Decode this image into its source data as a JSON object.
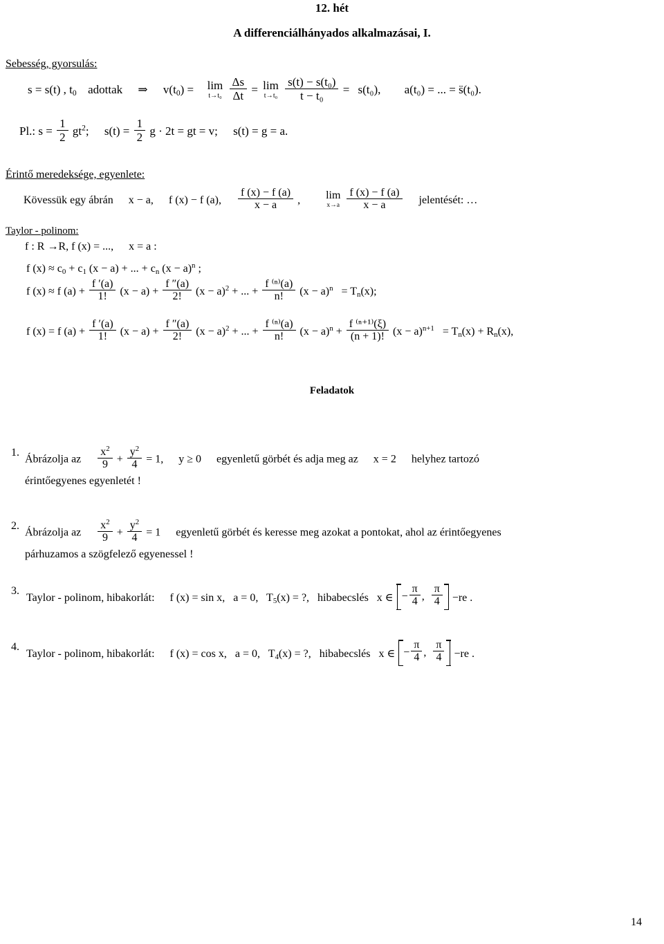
{
  "document": {
    "week_title": "12. hét",
    "main_title": "A differenciálhányados alkalmazásai, I.",
    "page_number": "14"
  },
  "section_velocity": {
    "heading": "Sebesség, gyorsulás:",
    "line1": {
      "lhs": "s = s(t) ,  t",
      "lhs_sub": "0",
      "given": "adottak",
      "implies": "⇒",
      "v_label": "v(t",
      "v_sub": "0",
      "v_close": ") =",
      "lim1_op": "lim",
      "lim1_under": "t→t₀",
      "frac1_num": "Δs",
      "frac1_den": "Δt",
      "eq1": "=",
      "lim2_op": "lim",
      "lim2_under": "t→t₀",
      "frac2_num": "s(t) − s(t₀)",
      "frac2_den": "t − t₀",
      "eq2": "=",
      "sdot": "s(t₀),",
      "accel": "a(t₀) = ... = s̈(t₀)."
    },
    "line2": {
      "prefix": "Pl.:  s =",
      "frac_num": "1",
      "frac_den": "2",
      "term1": "gt",
      "term1_sup": "2",
      "semi": ";",
      "sdot_label": "s(t) =",
      "frac2_num": "1",
      "frac2_den": "2",
      "term2": "g · 2t = gt = v;",
      "sddot_label": "s(t) = g = a."
    }
  },
  "section_tangent": {
    "heading": "Érintő meredeksége, egyenlete:",
    "lead": "Kövessük egy ábrán",
    "item1": "x − a,",
    "item2": "f (x) − f (a),",
    "frac_num": "f (x) − f (a)",
    "frac_den": "x − a",
    "comma": ",",
    "lim_op": "lim",
    "lim_under": "x→a",
    "frac2_num": "f (x) − f (a)",
    "frac2_den": "x − a",
    "trailing": "jelentését: …"
  },
  "section_taylor": {
    "heading": "Taylor - polinom:",
    "domain_line": "f : R →R,  f (x) = ...,",
    "domain_at": "x = a :",
    "approx_line": {
      "lhs": "f (x) ≈ c",
      "c0_sub": "0",
      "plus1": "+ c",
      "c1_sub": "1",
      "term1": "(x − a) + ... + c",
      "cn_sub": "n",
      "term2": "(x − a)",
      "term2_sup": "n",
      "semi": ";"
    },
    "formula_tn": {
      "lhs": "f (x) ≈ f (a) +",
      "f1_num": "f ′(a)",
      "f1_den": "1!",
      "t1": "(x − a) +",
      "f2_num": "f ″(a)",
      "f2_den": "2!",
      "t2": "(x − a)",
      "t2_sup": "2",
      "mid": "+ ... +",
      "fn_num": "f ⁽ⁿ⁾(a)",
      "fn_den": "n!",
      "t3": "(x − a)",
      "t3_sup": "n",
      "rhs": "= T",
      "rhs_sub": "n",
      "rhs_tail": "(x);"
    },
    "formula_full": {
      "lhs": "f (x) = f (a) +",
      "f1_num": "f ′(a)",
      "f1_den": "1!",
      "t1": "(x − a) +",
      "f2_num": "f ″(a)",
      "f2_den": "2!",
      "t2": "(x − a)",
      "t2_sup": "2",
      "mid": "+ ... +",
      "fn_num": "f ⁽ⁿ⁾(a)",
      "fn_den": "n!",
      "t3": "(x − a)",
      "t3_sup": "n",
      "plus": "+",
      "fr_num": "f ⁽ⁿ⁺¹⁾(ξ)",
      "fr_den": "(n + 1)!",
      "t4": "(x − a)",
      "t4_sup": "n+1",
      "rhs": "= T",
      "rhs_sub": "n",
      "rhs_mid": "(x) + R",
      "rhs_sub2": "n",
      "rhs_tail": "(x),"
    }
  },
  "exercises_heading": "Feladatok",
  "exercises": [
    {
      "num": "1.",
      "pre": "Ábrázolja  az",
      "frac1_num": "x",
      "frac1_num_sup": "2",
      "frac1_den": "9",
      "plus": "+",
      "frac2_num": "y",
      "frac2_num_sup": "2",
      "frac2_den": "4",
      "eq": "= 1,",
      "cond": "y ≥ 0",
      "mid": "egyenletű  görbét  és  adja  meg  az",
      "at": "x = 2",
      "tail": "helyhez  tartozó",
      "line2": "érintőegyenes egyenletét !"
    },
    {
      "num": "2.",
      "pre": "Ábrázolja az",
      "frac1_num": "x",
      "frac1_num_sup": "2",
      "frac1_den": "9",
      "plus": "+",
      "frac2_num": "y",
      "frac2_num_sup": "2",
      "frac2_den": "4",
      "eq": "= 1",
      "mid": "egyenletű görbét és keresse meg azokat a pontokat, ahol az érintőegyenes",
      "line2": "párhuzamos a szögfelező egyenessel !"
    },
    {
      "num": "3.",
      "pre": "Taylor - polinom, hibakorlát:",
      "fx": "f (x) = sin x,",
      "a": "a = 0,",
      "T": "T",
      "T_sub": "5",
      "T_tail": "(x) = ?,",
      "err": "hibabecslés",
      "inval": "x ∈",
      "br_left_num": "π",
      "br_left_den": "4",
      "br_left_sign": "−",
      "br_comma": ",",
      "br_right_num": "π",
      "br_right_den": "4",
      "tail": "−re ."
    },
    {
      "num": "4.",
      "pre": "Taylor - polinom, hibakorlát:",
      "fx": "f (x) = cos x,",
      "a": "a = 0,",
      "T": "T",
      "T_sub": "4",
      "T_tail": "(x) = ?,",
      "err": "hibabecslés",
      "inval": "x ∈",
      "br_left_num": "π",
      "br_left_den": "4",
      "br_left_sign": "−",
      "br_comma": ",",
      "br_right_num": "π",
      "br_right_den": "4",
      "tail": "−re ."
    }
  ]
}
